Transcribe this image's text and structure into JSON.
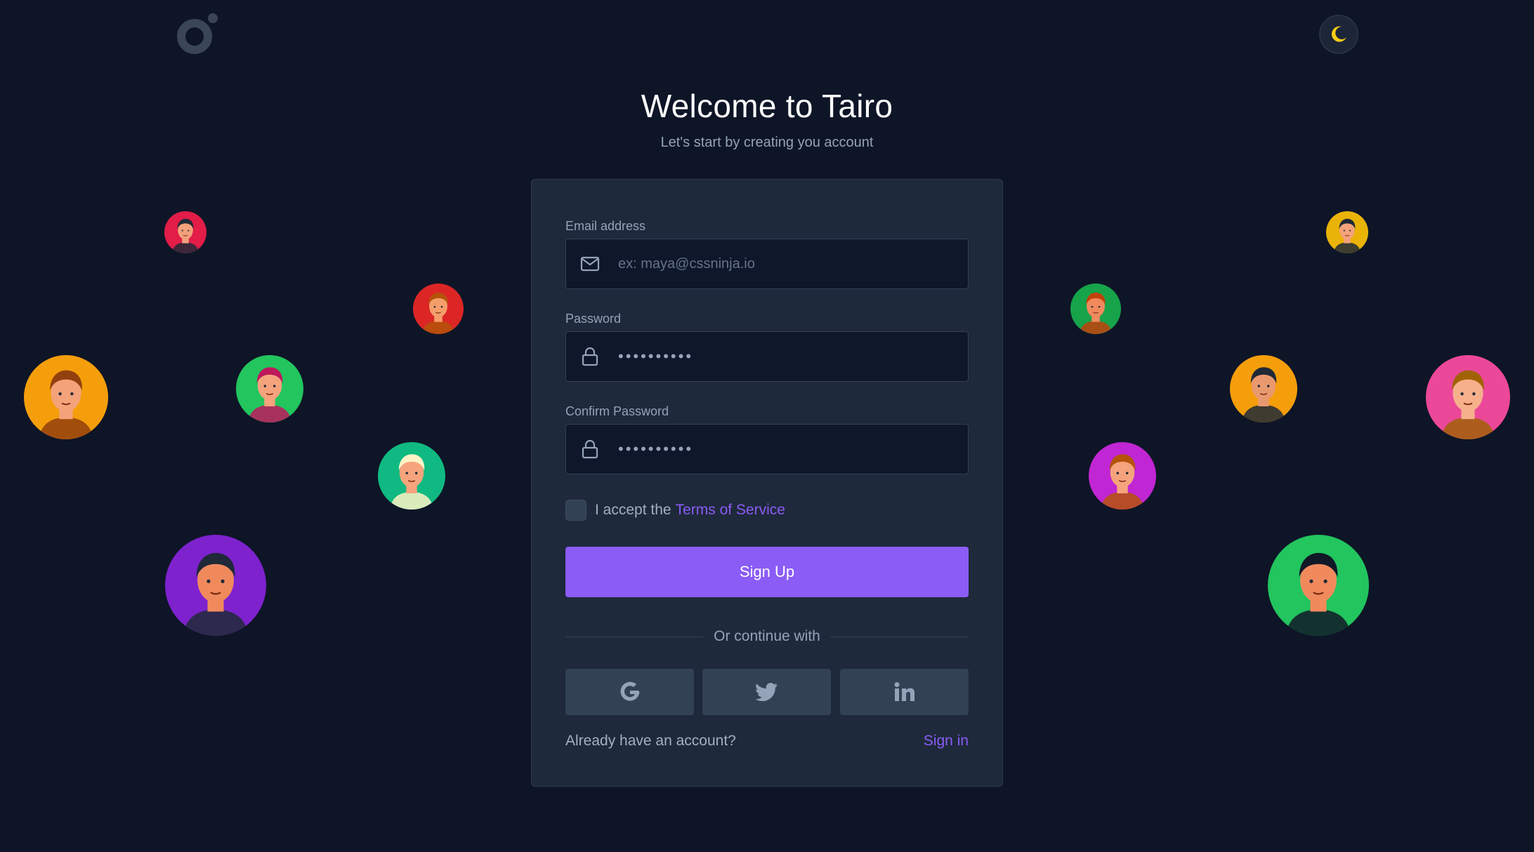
{
  "app": {
    "logo_icon": "tairo-logo-icon",
    "theme_toggle_icon": "moon-icon"
  },
  "heading": {
    "title": "Welcome to Tairo",
    "subtitle": "Let's start by creating you account"
  },
  "form": {
    "email": {
      "label": "Email address",
      "placeholder": "ex: maya@cssninja.io",
      "value": "",
      "icon": "mail-icon"
    },
    "password": {
      "label": "Password",
      "value": "••••••••••",
      "icon": "lock-icon"
    },
    "confirm_password": {
      "label": "Confirm Password",
      "value": "••••••••••",
      "icon": "lock-icon"
    },
    "terms": {
      "checked": false,
      "text": "I accept the",
      "link": "Terms of Service"
    },
    "submit_label": "Sign Up",
    "divider_text": "Or continue with",
    "social": [
      {
        "name": "google",
        "icon": "google-icon"
      },
      {
        "name": "twitter",
        "icon": "twitter-icon"
      },
      {
        "name": "linkedin",
        "icon": "linkedin-icon"
      }
    ],
    "footer": {
      "question": "Already have an account?",
      "link": "Sign in"
    }
  },
  "colors": {
    "background": "#0e1527",
    "card": "#1e293b",
    "accent": "#8b5cf6",
    "input_bg": "#0f172a"
  },
  "avatars": [
    {
      "bg": "#e11d48",
      "skin": "#f2a07b",
      "hair": "#1f2937"
    },
    {
      "bg": "#dc2626",
      "skin": "#f59e6b",
      "hair": "#b45309"
    },
    {
      "bg": "#f59e0b",
      "skin": "#f4a27a",
      "hair": "#92400e"
    },
    {
      "bg": "#22c55e",
      "skin": "#f5a37c",
      "hair": "#be185d"
    },
    {
      "bg": "#10b981",
      "skin": "#f6a47d",
      "hair": "#fef3c7"
    },
    {
      "bg": "#7e22ce",
      "skin": "#f08a5d",
      "hair": "#1f2937"
    },
    {
      "bg": "#eab308",
      "skin": "#f4a27a",
      "hair": "#1f2937"
    },
    {
      "bg": "#16a34a",
      "skin": "#f08a5d",
      "hair": "#c2410c"
    },
    {
      "bg": "#f59e0b",
      "skin": "#e9996e",
      "hair": "#1f2937"
    },
    {
      "bg": "#ec4899",
      "skin": "#f6b08c",
      "hair": "#a16207"
    },
    {
      "bg": "#c026d3",
      "skin": "#f5a37c",
      "hair": "#b45309"
    },
    {
      "bg": "#22c55e",
      "skin": "#f08a5d",
      "hair": "#111827"
    }
  ]
}
